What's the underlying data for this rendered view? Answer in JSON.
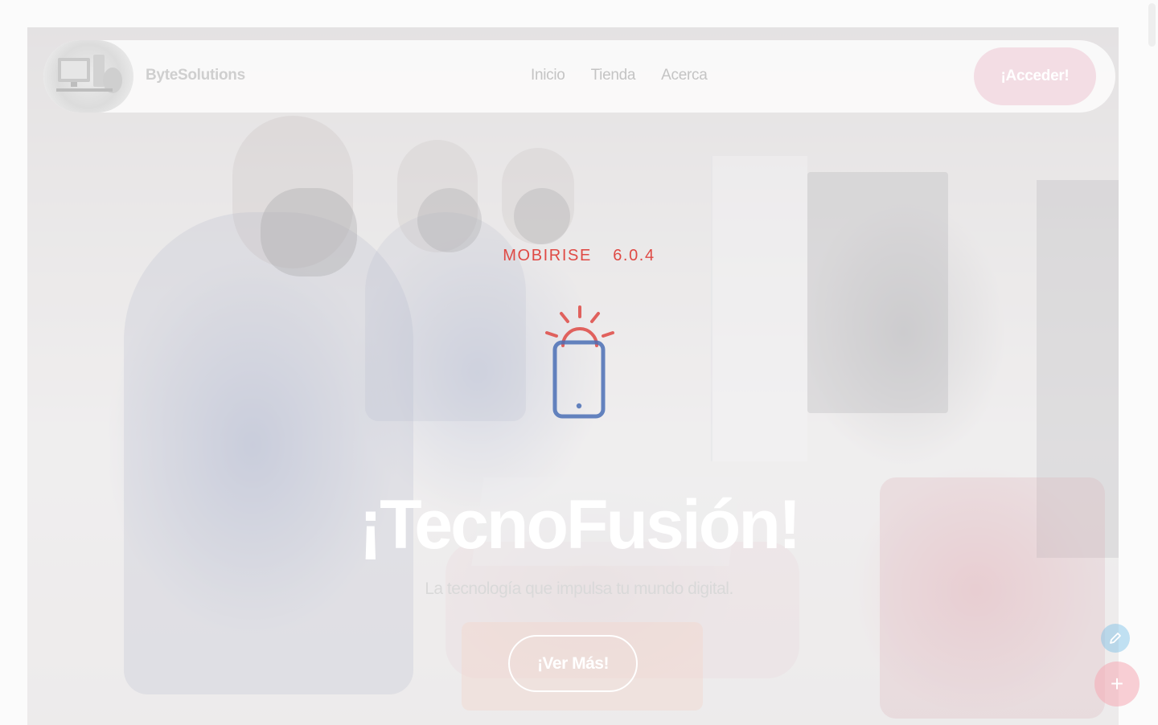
{
  "navbar": {
    "brand": "ByteSolutions",
    "links": [
      {
        "label": "Inicio"
      },
      {
        "label": "Tienda"
      },
      {
        "label": "Acerca"
      }
    ],
    "login_label": "¡Acceder!"
  },
  "hero": {
    "kicker": "MOBIRISE  6.0.4",
    "icon": "phone-alert-icon",
    "title": "¡TecnoFusión!",
    "subtitle": "La tecnología que impulsa tu mundo digital.",
    "cta_label": "¡Ver Más!"
  },
  "floating": {
    "edit_icon": "pencil-icon",
    "add_icon": "plus-icon",
    "add_glyph": "+"
  },
  "colors": {
    "accent": "#df4a45",
    "icon_blue": "#4a6fb5",
    "login_bg": "#f3dde4"
  }
}
